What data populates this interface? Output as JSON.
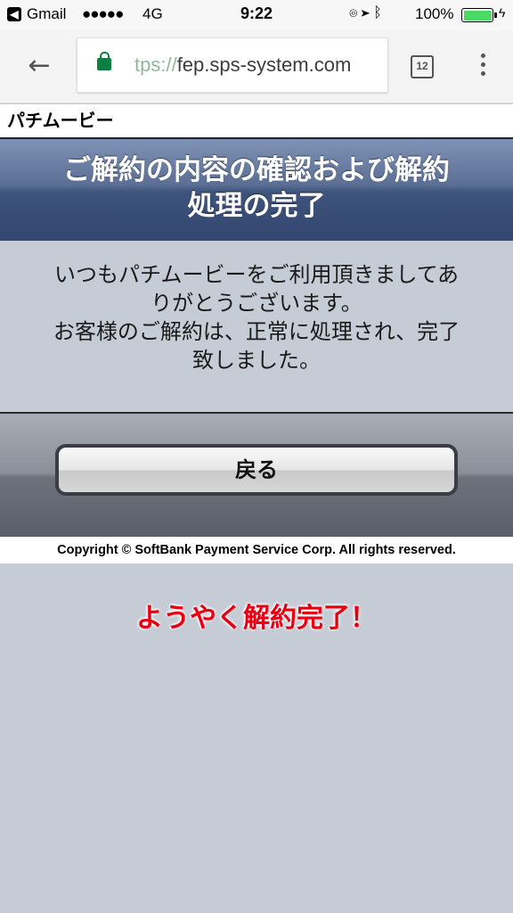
{
  "status_bar": {
    "back_app_icon": "back-triangle-icon",
    "app_name": "Gmail",
    "signal": "●●●●●",
    "network": "4G",
    "time": "9:22",
    "battery_percent": "100%",
    "battery_level": 1.0,
    "battery_color": "#4cd964"
  },
  "browser": {
    "url_scheme": "tps://",
    "url_host": "fep.sps-system.com",
    "tabs_count": "12",
    "lock_color": "#0b8043"
  },
  "page": {
    "site_name": "パチムービー",
    "title_line1": "ご解約の内容の確認および解約",
    "title_line2": "処理の完了",
    "message_line1": "いつもパチムービーをご利用頂きましてあ",
    "message_line2": "りがとうございます。",
    "message_line3": "お客様のご解約は、正常に処理され、完了",
    "message_line4": "致しました。",
    "back_button_label": "戻る",
    "copyright": "Copyright © SoftBank Payment Service Corp. All rights reserved."
  },
  "annotation": {
    "text": "ようやく解約完了！",
    "color": "#e60012"
  }
}
